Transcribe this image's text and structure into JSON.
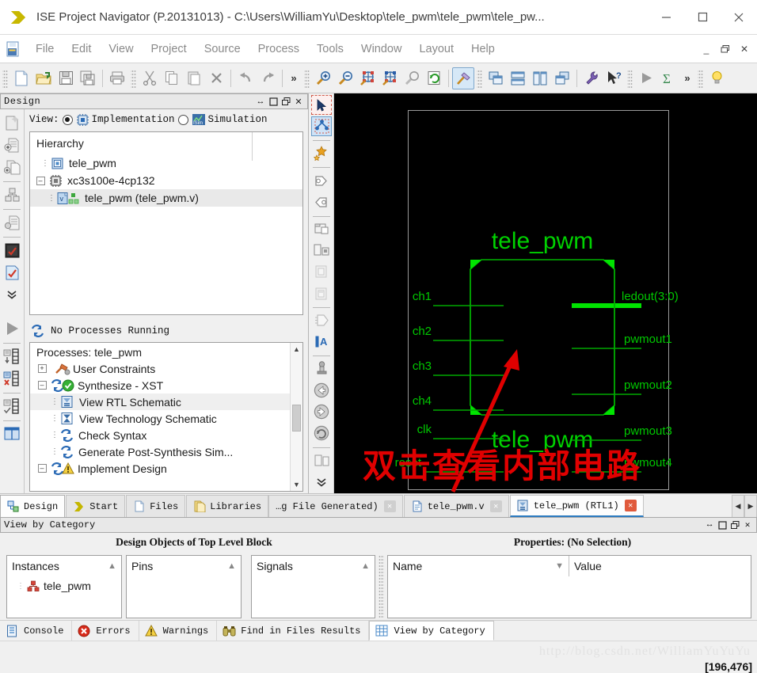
{
  "window": {
    "title": "ISE Project Navigator (P.20131013) - C:\\Users\\WilliamYu\\Desktop\\tele_pwm\\tele_pwm\\tele_pw...",
    "minimize": "–",
    "maximize": "☐",
    "close": "✕",
    "app_icon": "ise-logo-icon"
  },
  "menu": {
    "items": [
      {
        "label": "File"
      },
      {
        "label": "Edit"
      },
      {
        "label": "View"
      },
      {
        "label": "Project"
      },
      {
        "label": "Source"
      },
      {
        "label": "Process"
      },
      {
        "label": "Tools"
      },
      {
        "label": "Window"
      },
      {
        "label": "Layout"
      },
      {
        "label": "Help"
      }
    ],
    "mdi_minimize": "_",
    "mdi_restore": "❐",
    "mdi_close": "✕"
  },
  "toolbar": {
    "groups": [
      {
        "buttons": [
          {
            "name": "new-file-button",
            "icon": "new-document-icon"
          },
          {
            "name": "open-file-button",
            "icon": "open-folder-icon"
          },
          {
            "name": "save-button",
            "icon": "floppy-disk-icon"
          },
          {
            "name": "save-all-button",
            "icon": "save-all-icon"
          }
        ]
      },
      {
        "buttons": [
          {
            "name": "print-button",
            "icon": "printer-icon"
          }
        ]
      },
      {
        "buttons": [
          {
            "name": "cut-button",
            "icon": "scissors-icon"
          },
          {
            "name": "copy-button",
            "icon": "copy-icon"
          },
          {
            "name": "paste-button",
            "icon": "paste-icon"
          },
          {
            "name": "delete-button",
            "icon": "x-delete-icon"
          }
        ]
      },
      {
        "buttons": [
          {
            "name": "undo-button",
            "icon": "undo-arrow-icon"
          },
          {
            "name": "redo-button",
            "icon": "redo-arrow-icon"
          }
        ]
      },
      {
        "buttons": [
          {
            "name": "zoom-in-button",
            "icon": "magnifier-plus-icon"
          },
          {
            "name": "zoom-out-button",
            "icon": "magnifier-minus-icon"
          },
          {
            "name": "zoom-fit-button",
            "icon": "zoom-fit-icon"
          },
          {
            "name": "zoom-selection-button",
            "icon": "zoom-selection-icon"
          },
          {
            "name": "zoom-area-button",
            "icon": "magnifier-gray-icon"
          },
          {
            "name": "refresh-button",
            "icon": "refresh-document-icon"
          }
        ]
      },
      {
        "buttons": [
          {
            "name": "design-tools-button",
            "icon": "hammer-icon",
            "active": true
          }
        ]
      },
      {
        "buttons": [
          {
            "name": "cascade-windows-button",
            "icon": "cascade-icon"
          },
          {
            "name": "tile-horizontal-button",
            "icon": "tile-horizontal-icon"
          },
          {
            "name": "tile-vertical-button",
            "icon": "tile-vertical-icon"
          },
          {
            "name": "arrange-windows-button",
            "icon": "arrange-icon"
          }
        ]
      },
      {
        "buttons": [
          {
            "name": "process-properties-button",
            "icon": "wrench-icon"
          },
          {
            "name": "context-help-button",
            "icon": "arrow-question-icon"
          }
        ]
      },
      {
        "buttons": [
          {
            "name": "run-button",
            "icon": "play-triangle-icon"
          },
          {
            "name": "summary-button",
            "icon": "sigma-icon"
          }
        ]
      },
      {
        "buttons": [
          {
            "name": "tip-button",
            "icon": "lightbulb-icon"
          }
        ]
      }
    ],
    "overflow": "»"
  },
  "design_panel": {
    "title": "Design",
    "title_buttons": [
      "↔",
      "❐",
      "❐",
      "✕"
    ],
    "view_label": "View:",
    "implementation_label": "Implementation",
    "simulation_label": "Simulation",
    "implementation_selected": true,
    "hierarchy_label": "Hierarchy",
    "tree": [
      {
        "label": "tele_pwm",
        "indent": 1,
        "icon": "project-icon",
        "expander": "",
        "selected": false
      },
      {
        "label": "xc3s100e-4cp132",
        "indent": 1,
        "icon": "chip-icon",
        "expander": "–",
        "selected": false
      },
      {
        "label": "tele_pwm (tele_pwm.v)",
        "indent": 2,
        "icon": "verilog-module-icon",
        "expander": "",
        "selected": true
      }
    ],
    "dock_icons": [
      "new-source-icon",
      "add-source-icon",
      "add-copy-source-icon",
      "implementation-icon",
      "design-summary-icon",
      "design-goals-icon",
      "design-utilities-icon",
      "expand-more-icon"
    ],
    "processes": {
      "status": "No Processes Running",
      "header": "Processes: tele_pwm",
      "rows": [
        {
          "label": "User Constraints",
          "indent": 1,
          "expander": "+",
          "icon": "user-constraints-icon",
          "badge": "",
          "selected": false
        },
        {
          "label": "Synthesize - XST",
          "indent": 1,
          "expander": "–",
          "icon": "process-icon",
          "badge": "check-green-icon",
          "selected": false
        },
        {
          "label": "View RTL Schematic",
          "indent": 2,
          "expander": "",
          "icon": "rtl-schematic-icon",
          "badge": "",
          "selected": true
        },
        {
          "label": "View Technology Schematic",
          "indent": 2,
          "expander": "",
          "icon": "tech-schematic-icon",
          "badge": "",
          "selected": false
        },
        {
          "label": "Check Syntax",
          "indent": 2,
          "expander": "",
          "icon": "process-icon",
          "badge": "",
          "selected": false
        },
        {
          "label": "Generate Post-Synthesis Sim...",
          "indent": 2,
          "expander": "",
          "icon": "process-icon",
          "badge": "",
          "selected": false
        },
        {
          "label": "Implement Design",
          "indent": 1,
          "expander": "–",
          "icon": "process-icon",
          "badge": "warning-yellow-icon",
          "selected": false
        }
      ],
      "dock_icons": [
        "run-process-icon",
        "rerun-icon",
        "rerun-all-icon",
        "stop-process-icon",
        "design-goals-panel-icon"
      ]
    }
  },
  "schematic": {
    "tools": [
      "select-pointer-icon",
      "select-area-net-icon",
      "add-marker-icon",
      "zoom-in-schematic-icon",
      "zoom-out-schematic-icon",
      "open-folder-schematic-icon",
      "new-sheet-icon",
      "previous-sheet-icon",
      "next-sheet-icon",
      "hierarchy-push-icon",
      "rename-label-icon",
      "pin-icon",
      "back-arrow-icon",
      "forward-arrow-icon",
      "refresh-schematic-icon",
      "toggle-panel-icon",
      "expand-more-icon"
    ],
    "block": {
      "title_top": "tele_pwm",
      "title_bottom": "tele_pwm",
      "inputs": [
        "ch1",
        "ch2",
        "ch3",
        "ch4",
        "clk",
        "reset"
      ],
      "outputs": [
        "ledout(3:0)",
        "pwmout1",
        "pwmout2",
        "pwmout3",
        "pwmout4"
      ],
      "bus_output_index": 0
    },
    "annotation_text": "双击查看内部电路",
    "colors": {
      "background": "#000000",
      "wire": "#00c000",
      "block_fill_accent": "#00e400",
      "label": "#00d000",
      "annotation": "#e00000",
      "frame": "#9a9a9a"
    }
  },
  "tabs": {
    "left": [
      {
        "label": "Design",
        "icon": "design-tab-icon",
        "active": true,
        "closable": false
      },
      {
        "label": "Start",
        "icon": "start-arrow-icon",
        "active": false,
        "closable": false
      },
      {
        "label": "Files",
        "icon": "files-icon",
        "active": false,
        "closable": false
      },
      {
        "label": "Libraries",
        "icon": "libraries-icon",
        "active": false,
        "closable": false
      }
    ],
    "documents": [
      {
        "label": "…g File Generated)",
        "icon": "",
        "active": false,
        "closable": true,
        "close_style": "gray"
      },
      {
        "label": "tele_pwm.v",
        "icon": "verilog-file-icon",
        "active": false,
        "closable": true,
        "close_style": "gray"
      },
      {
        "label": "tele_pwm (RTL1)",
        "icon": "rtl-schematic-icon",
        "active": true,
        "closable": true,
        "close_style": "red"
      }
    ],
    "nav_prev": "◀",
    "nav_next": "▶"
  },
  "bottom_panel": {
    "title": "View by Category",
    "title_buttons": [
      "↔",
      "❐",
      "❐",
      "✕"
    ],
    "heading_left": "Design Objects of Top Level Block",
    "heading_right": "Properties: (No Selection)",
    "lists": [
      {
        "header": "Instances",
        "sort": "▲",
        "rows": [
          {
            "label": "tele_pwm",
            "icon": "instance-red-icon"
          }
        ]
      },
      {
        "header": "Pins",
        "sort": "▲",
        "rows": []
      },
      {
        "header": "Signals",
        "sort": "▲",
        "rows": []
      }
    ],
    "properties": {
      "col_name": "Name",
      "col_value": "Value",
      "sort": "▼",
      "rows": []
    }
  },
  "statusbar": {
    "tabs": [
      {
        "label": "Console",
        "icon": "console-icon",
        "active": false
      },
      {
        "label": "Errors",
        "icon": "error-red-icon",
        "active": false
      },
      {
        "label": "Warnings",
        "icon": "warning-yellow-icon",
        "active": false
      },
      {
        "label": "Find in Files Results",
        "icon": "binoculars-icon",
        "active": false
      },
      {
        "label": "View by Category",
        "icon": "grid-table-icon",
        "active": true
      }
    ],
    "watermark": "http://blog.csdn.net/WilliamYuYuYu",
    "coordinates": "[196,476]"
  }
}
